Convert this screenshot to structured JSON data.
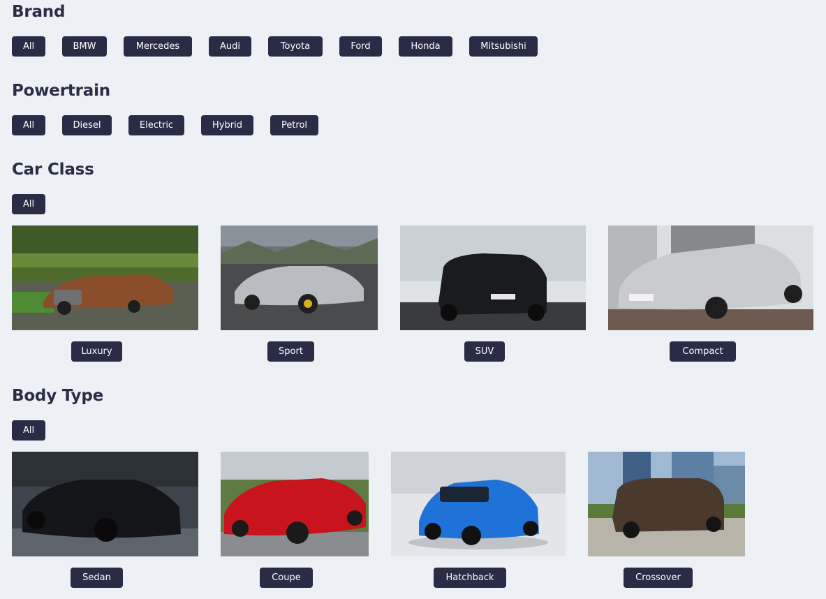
{
  "brand": {
    "heading": "Brand",
    "chips": [
      "All",
      "BMW",
      "Mercedes",
      "Audi",
      "Toyota",
      "Ford",
      "Honda",
      "Mitsubishi"
    ]
  },
  "powertrain": {
    "heading": "Powertrain",
    "chips": [
      "All",
      "Diesel",
      "Electric",
      "Hybrid",
      "Petrol"
    ]
  },
  "car_class": {
    "heading": "Car Class",
    "all": "All",
    "items": [
      {
        "label": "Luxury",
        "image": "bronze-luxury-sedan-photo",
        "car_color": "#8a4e2c"
      },
      {
        "label": "Sport",
        "image": "silver-sports-coupe-photo",
        "car_color": "#b9bcc0"
      },
      {
        "label": "SUV",
        "image": "black-suv-photo",
        "car_color": "#1a1b1e"
      },
      {
        "label": "Compact",
        "image": "silver-compact-hatchback-photo",
        "car_color": "#c9cbce"
      }
    ]
  },
  "body_type": {
    "heading": "Body Type",
    "all": "All",
    "items": [
      {
        "label": "Sedan",
        "image": "black-sedan-photo",
        "car_color": "#141518"
      },
      {
        "label": "Coupe",
        "image": "red-coupe-photo",
        "car_color": "#c8141c"
      },
      {
        "label": "Hatchback",
        "image": "blue-hatchback-photo",
        "car_color": "#1f73d8"
      },
      {
        "label": "Crossover",
        "image": "brown-crossover-photo",
        "car_color": "#4a3a2e"
      }
    ]
  },
  "colors": {
    "chip_bg": "#292c44",
    "page_bg": "#edf1f5",
    "heading": "#2a2d45"
  }
}
